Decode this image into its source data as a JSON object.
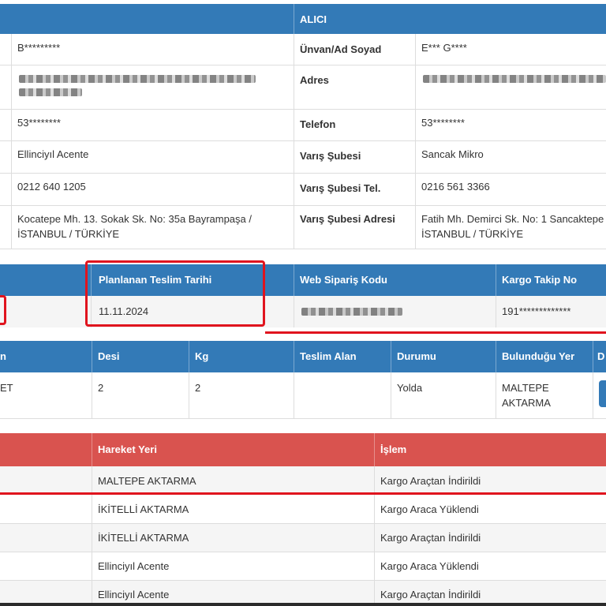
{
  "receiver": {
    "header": "ALICI",
    "sender_values": {
      "name": "B*********",
      "phone": "53********",
      "branch": "Ellinciyıl Acente",
      "branch_phone": "0212 640 1205",
      "branch_address": "Kocatepe Mh. 13. Sokak Sk. No: 35a Bayrampaşa / İSTANBUL / TÜRKİYE"
    },
    "labels": {
      "name": "Ünvan/Ad Soyad",
      "address": "Adres",
      "phone": "Telefon",
      "branch": "Varış Şubesi",
      "branch_phone": "Varış Şubesi Tel.",
      "branch_address": "Varış Şubesi Adresi"
    },
    "values": {
      "name": "E*** G****",
      "phone": "53********",
      "branch": "Sancak Mikro",
      "branch_phone": "0216 561 3366",
      "branch_address": "Fatih Mh. Demirci Sk. No: 1 Sancaktepe / İSTANBUL / TÜRKİYE"
    }
  },
  "shipment": {
    "headers": [
      "Planlanan Teslim Tarihi",
      "Web Sipariş Kodu",
      "Kargo Takip No"
    ],
    "values": {
      "planned_date": "11.11.2024",
      "tracking_no": "191*************"
    }
  },
  "package": {
    "headers": [
      "n",
      "Desi",
      "Kg",
      "Teslim Alan",
      "Durumu",
      "Bulunduğu Yer",
      "D"
    ],
    "row": {
      "first": "ET",
      "desi": "2",
      "kg": "2",
      "received_by": "",
      "status": "Yolda",
      "location": "MALTEPE AKTARMA"
    }
  },
  "movements": {
    "headers": [
      "Hareket Yeri",
      "İşlem"
    ],
    "rows": [
      {
        "place": "MALTEPE AKTARMA",
        "action": "Kargo Araçtan İndirildi"
      },
      {
        "place": "İKİTELLİ AKTARMA",
        "action": "Kargo Araca Yüklendi"
      },
      {
        "place": "İKİTELLİ AKTARMA",
        "action": "Kargo Araçtan İndirildi"
      },
      {
        "place": "Ellinciyıl Acente",
        "action": "Kargo Araca Yüklendi"
      },
      {
        "place": "Ellinciyıl Acente",
        "action": "Kargo Araçtan İndirildi"
      }
    ]
  },
  "colors": {
    "header_blue": "#337ab7",
    "header_red": "#d9534f",
    "highlight_red": "#e0141e"
  }
}
